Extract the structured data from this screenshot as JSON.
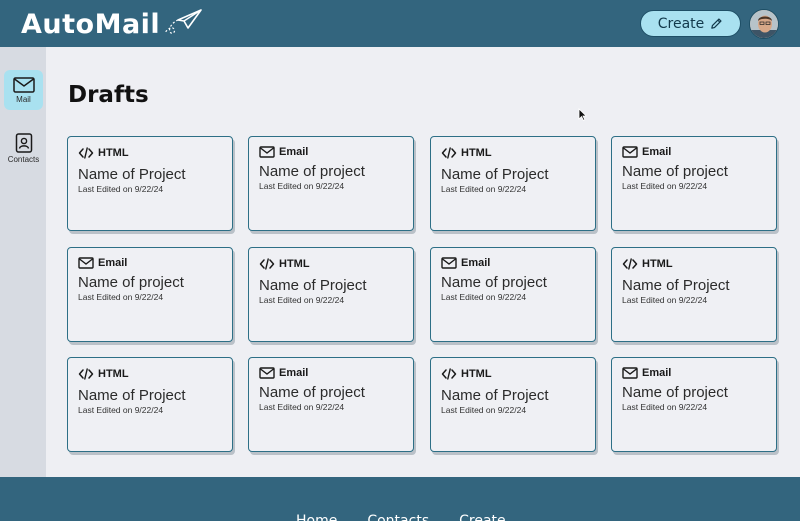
{
  "app": {
    "title": "AutoMail"
  },
  "header": {
    "create_label": "Create"
  },
  "sidebar": {
    "items": [
      {
        "label": "Mail",
        "icon": "mail-icon",
        "active": true
      },
      {
        "label": "Contacts",
        "icon": "contacts-icon",
        "active": false
      }
    ]
  },
  "main": {
    "title": "Drafts",
    "cards": [
      {
        "type": "HTML",
        "name": "Name of Project",
        "date": "Last Edited on 9/22/24"
      },
      {
        "type": "Email",
        "name": "Name of project",
        "date": "Last Edited on 9/22/24"
      },
      {
        "type": "HTML",
        "name": "Name of Project",
        "date": "Last Edited on 9/22/24"
      },
      {
        "type": "Email",
        "name": "Name of project",
        "date": "Last Edited on 9/22/24"
      },
      {
        "type": "Email",
        "name": "Name of project",
        "date": "Last Edited on 9/22/24"
      },
      {
        "type": "HTML",
        "name": "Name of Project",
        "date": "Last Edited on 9/22/24"
      },
      {
        "type": "Email",
        "name": "Name of project",
        "date": "Last Edited on 9/22/24"
      },
      {
        "type": "HTML",
        "name": "Name of Project",
        "date": "Last Edited on 9/22/24"
      },
      {
        "type": "HTML",
        "name": "Name of Project",
        "date": "Last Edited on 9/22/24"
      },
      {
        "type": "Email",
        "name": "Name of project",
        "date": "Last Edited on 9/22/24"
      },
      {
        "type": "HTML",
        "name": "Name of Project",
        "date": "Last Edited on 9/22/24"
      },
      {
        "type": "Email",
        "name": "Name of project",
        "date": "Last Edited on 9/22/24"
      }
    ]
  },
  "footer": {
    "links": [
      "Home",
      "Contacts",
      "Create"
    ]
  },
  "colors": {
    "brand": "#33657e",
    "accent": "#a9e1f0",
    "card_border": "#2d6f86",
    "background": "#eeeff3"
  }
}
